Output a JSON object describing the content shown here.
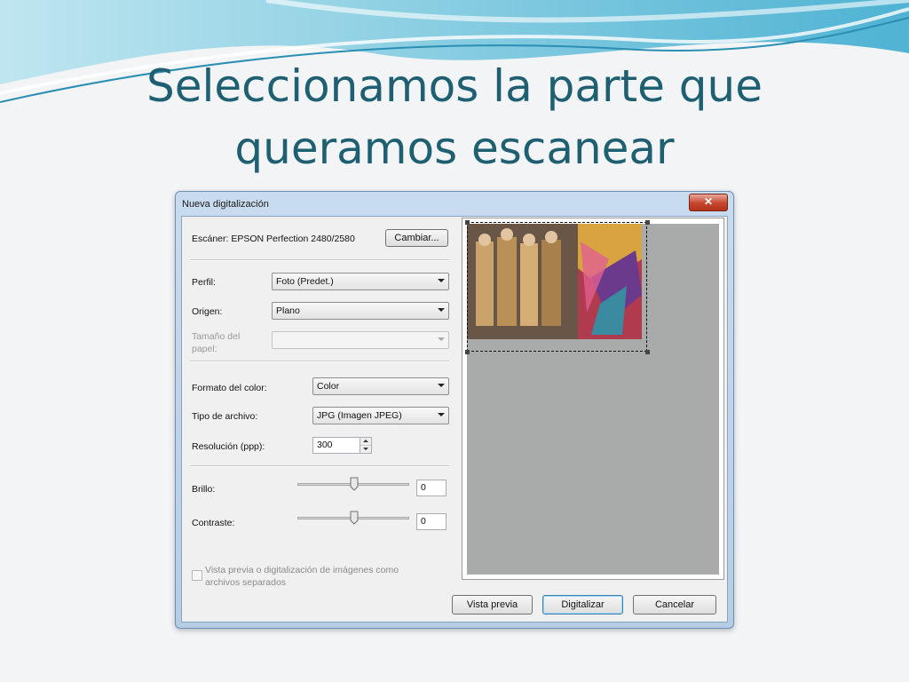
{
  "slide": {
    "title_line1": "Seleccionamos la parte que",
    "title_line2": "queramos escanear"
  },
  "dialog": {
    "title": "Nueva digitalización",
    "close_symbol": "✕",
    "scanner_label": "Escáner: EPSON Perfection 2480/2580",
    "change_button": "Cambiar...",
    "profile": {
      "label": "Perfil:",
      "value": "Foto (Predet.)"
    },
    "source": {
      "label": "Origen:",
      "value": "Plano"
    },
    "paper_size": {
      "label_line1": "Tamaño del",
      "label_line2": "papel:",
      "value": ""
    },
    "color_format": {
      "label": "Formato del color:",
      "value": "Color"
    },
    "file_type": {
      "label": "Tipo de archivo:",
      "value": "JPG (Imagen JPEG)"
    },
    "resolution": {
      "label": "Resolución (ppp):",
      "value": "300"
    },
    "brightness": {
      "label": "Brillo:",
      "value": "0"
    },
    "contrast": {
      "label": "Contraste:",
      "value": "0"
    },
    "separate_files": {
      "label_line1": "Vista previa o digitalización de imágenes como",
      "label_line2": "archivos separados",
      "checked": false
    },
    "buttons": {
      "preview": "Vista previa",
      "scan": "Digitalizar",
      "cancel": "Cancelar"
    }
  },
  "colors": {
    "title": "#1f5f72",
    "swoosh": "#5bb8d6",
    "preview_bg": "#a9aaaa"
  },
  "icons": {
    "close": "close-icon",
    "dropdown": "chevron-down-icon"
  }
}
